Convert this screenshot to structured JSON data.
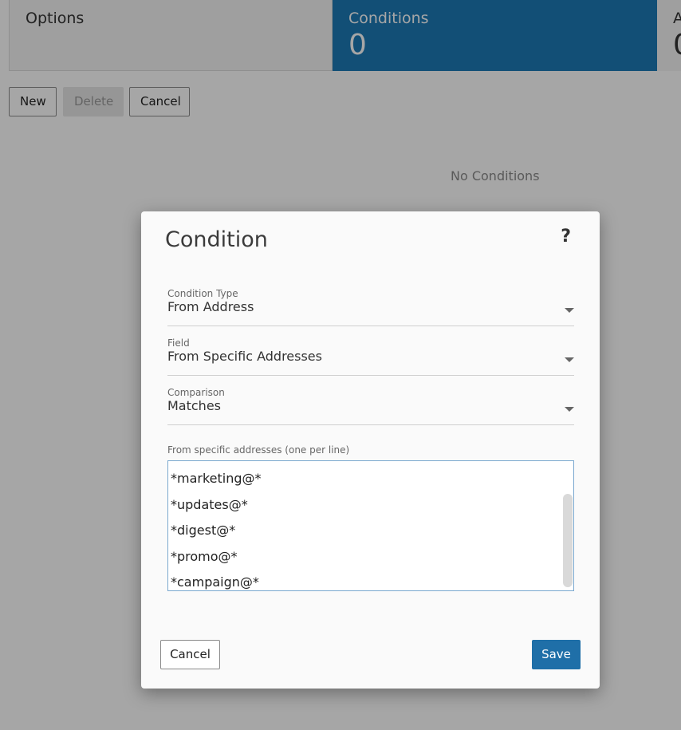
{
  "tabs": [
    {
      "label": "Options",
      "count": ""
    },
    {
      "label": "Conditions",
      "count": "0"
    },
    {
      "label": "A",
      "count": "0"
    }
  ],
  "toolbar": {
    "new_label": "New",
    "delete_label": "Delete",
    "cancel_label": "Cancel"
  },
  "empty_state": "No Conditions",
  "modal": {
    "title": "Condition",
    "help": "?",
    "condition_type": {
      "label": "Condition Type",
      "value": "From Address"
    },
    "field": {
      "label": "Field",
      "value": "From Specific Addresses"
    },
    "comparison": {
      "label": "Comparison",
      "value": "Matches"
    },
    "addresses": {
      "label": "From specific addresses (one per line)",
      "lines": [
        "*marketing@*",
        "*updates@*",
        "*digest@*",
        "*promo@*",
        "*campaign@*"
      ]
    },
    "cancel_label": "Cancel",
    "save_label": "Save"
  },
  "colors": {
    "accent": "#1d7ab6",
    "save_button": "#1f6fa8"
  }
}
